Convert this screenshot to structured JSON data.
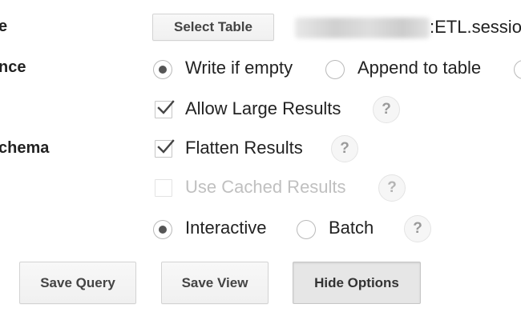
{
  "labels": {
    "destination_table": "e",
    "write_preference": "nce",
    "schema": "chema"
  },
  "destination": {
    "select_table_label": "Select Table",
    "dataset_suffix": ":ETL.sessio"
  },
  "write_preference": {
    "options": [
      "Write if empty",
      "Append to table"
    ],
    "selected": "Write if empty"
  },
  "options": {
    "allow_large_results": {
      "label": "Allow Large Results",
      "checked": true,
      "help": "?"
    },
    "flatten_results": {
      "label": "Flatten Results",
      "checked": true,
      "help": "?"
    },
    "use_cached_results": {
      "label": "Use Cached Results",
      "checked": false,
      "disabled": true,
      "help": "?"
    }
  },
  "query_priority": {
    "options": [
      "Interactive",
      "Batch"
    ],
    "selected": "Interactive",
    "help": "?"
  },
  "actions": {
    "save_query": "Save Query",
    "save_view": "Save View",
    "hide_options": "Hide Options"
  }
}
